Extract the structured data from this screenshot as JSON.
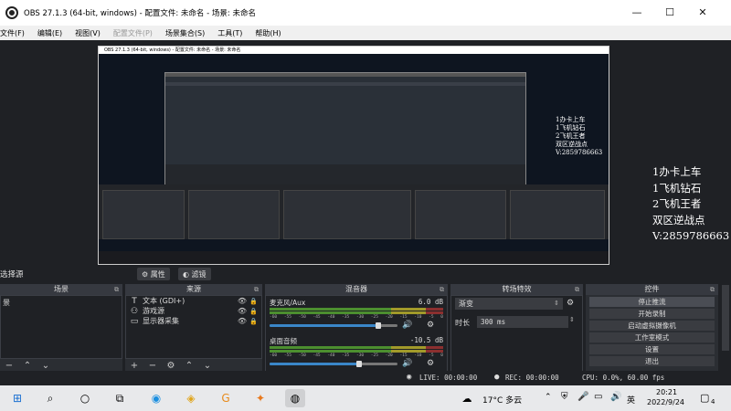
{
  "window": {
    "title": "OBS 27.1.3 (64-bit, windows) - 配置文件: 未命名 - 场景: 未命名",
    "min": "—",
    "max": "☐",
    "close": "✕"
  },
  "menu": [
    "文件(F)",
    "编辑(E)",
    "视图(V)",
    "配置文件(P)",
    "场景集合(S)",
    "工具(T)",
    "帮助(H)"
  ],
  "preview": {
    "title": "OBS 27.1.3 (64-bit, windows) - 配置文件: 未命名 - 场景: 未命名",
    "overlay_lines": "1办卡上车\n1飞机钻石\n2飞机王者\n双区逆战点\nV:2859786663"
  },
  "overlay_text": [
    "1办卡上车",
    "1飞机钻石",
    "2飞机王者",
    "双区逆战点",
    "V:2859786663"
  ],
  "toolbar": {
    "selected_label": "选择源",
    "properties": "属性",
    "filters": "滤镜"
  },
  "docks": {
    "scenes": {
      "header": "场景",
      "items": [
        "景"
      ]
    },
    "sources": {
      "header": "来源",
      "items": [
        {
          "label": "文本 (GDI+)",
          "icon": "T"
        },
        {
          "label": "游戏源",
          "icon": "⚇"
        },
        {
          "label": "显示器采集",
          "icon": "▭"
        }
      ]
    },
    "mixer": {
      "header": "混音器",
      "channels": [
        {
          "name": "麦克风/Aux",
          "db": "6.0 dB",
          "level": 0.85
        },
        {
          "name": "桌面音频",
          "db": "-10.5 dB",
          "level": 0.7
        }
      ],
      "ticks": [
        "-60",
        "-55",
        "-50",
        "-45",
        "-40",
        "-35",
        "-30",
        "-25",
        "-20",
        "-15",
        "-10",
        "-5",
        "0"
      ]
    },
    "transitions": {
      "header": "转场特效",
      "selected": "渐变",
      "duration_label": "时长",
      "duration_value": "300 ms"
    },
    "controls": {
      "header": "控件",
      "buttons": [
        "停止推流",
        "开始录制",
        "启动虚拟摄像机",
        "工作室模式",
        "设置",
        "退出"
      ]
    }
  },
  "status": {
    "live": "LIVE: 00:00:00",
    "rec": "REC: 00:00:00",
    "cpu": "CPU: 0.0%, 60.00 fps"
  },
  "taskbar": {
    "weather": "17°C 多云",
    "ime": "英",
    "time": "20:21",
    "date": "2022/9/24",
    "notify_count": "4"
  }
}
